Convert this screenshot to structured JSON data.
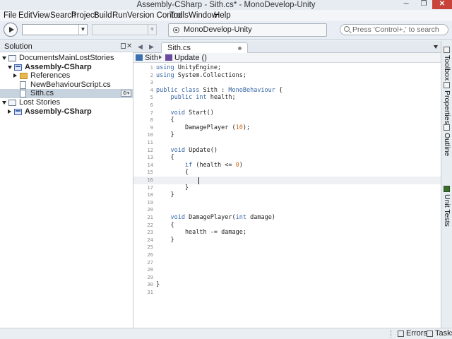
{
  "window": {
    "title": "Assembly-CSharp - Sith.cs* - MonoDevelop-Unity",
    "min": "─",
    "max": "❐",
    "close": "✕"
  },
  "menu": [
    "File",
    "Edit",
    "View",
    "Search",
    "Project",
    "Build",
    "Run",
    "Version Control",
    "Tools",
    "Window",
    "Help"
  ],
  "toolbar": {
    "config_value": "",
    "platform_value": "",
    "status_text": "MonoDevelop-Unity",
    "search_placeholder": "Press 'Control+,' to search"
  },
  "solution": {
    "title": "Solution",
    "close": "✕",
    "tree": [
      {
        "label": "DocumentsMainLostStories",
        "bold": false,
        "icon": "solution-icon",
        "expander": "down",
        "indent": 0
      },
      {
        "label": "Assembly-CSharp",
        "bold": true,
        "icon": "project-icon",
        "expander": "down",
        "indent": 1
      },
      {
        "label": "References",
        "bold": false,
        "icon": "folder-icon",
        "expander": "right",
        "indent": 2
      },
      {
        "label": "NewBehaviourScript.cs",
        "bold": false,
        "icon": "file-icon",
        "expander": "",
        "indent": 2
      },
      {
        "label": "Sith.cs",
        "bold": false,
        "icon": "file-icon",
        "expander": "",
        "indent": 2,
        "selected": true
      },
      {
        "label": "Lost Stories",
        "bold": false,
        "icon": "solution-icon",
        "expander": "down",
        "indent": 0
      },
      {
        "label": "Assembly-CSharp",
        "bold": true,
        "icon": "project-icon",
        "expander": "right",
        "indent": 1
      }
    ],
    "gear": "⚙▾"
  },
  "editor": {
    "tab_label": "Sith.cs",
    "nav_back": "◀",
    "nav_forward": "▶",
    "path_class": "Sith",
    "path_member": "Update ()",
    "current_line": 16,
    "lines": [
      [
        {
          "t": "using",
          "c": "kw"
        },
        {
          "t": " UnityEngine;"
        }
      ],
      [
        {
          "t": "using",
          "c": "kw"
        },
        {
          "t": " System.Collections;"
        }
      ],
      [],
      [
        {
          "t": "public class",
          "c": "kw"
        },
        {
          "t": " Sith : "
        },
        {
          "t": "MonoBehaviour",
          "c": "kw"
        },
        {
          "t": " {"
        }
      ],
      [
        {
          "t": "    "
        },
        {
          "t": "public int",
          "c": "kw"
        },
        {
          "t": " health;"
        }
      ],
      [],
      [
        {
          "t": "    "
        },
        {
          "t": "void",
          "c": "kw"
        },
        {
          "t": " Start()"
        }
      ],
      [
        {
          "t": "    {"
        }
      ],
      [
        {
          "t": "        DamagePlayer ("
        },
        {
          "t": "10",
          "c": "num"
        },
        {
          "t": ");"
        }
      ],
      [
        {
          "t": "    }"
        }
      ],
      [],
      [
        {
          "t": "    "
        },
        {
          "t": "void",
          "c": "kw"
        },
        {
          "t": " Update()"
        }
      ],
      [
        {
          "t": "    {"
        }
      ],
      [
        {
          "t": "        "
        },
        {
          "t": "if",
          "c": "kw"
        },
        {
          "t": " (health <= "
        },
        {
          "t": "0",
          "c": "num"
        },
        {
          "t": ")"
        }
      ],
      [
        {
          "t": "        {"
        }
      ],
      [],
      [
        {
          "t": "        }"
        }
      ],
      [
        {
          "t": "    }"
        }
      ],
      [],
      [],
      [
        {
          "t": "    "
        },
        {
          "t": "void",
          "c": "kw"
        },
        {
          "t": " DamagePlayer("
        },
        {
          "t": "int",
          "c": "kw"
        },
        {
          "t": " damage)"
        }
      ],
      [
        {
          "t": "    {"
        }
      ],
      [
        {
          "t": "        health -= damage;"
        }
      ],
      [
        {
          "t": "    }"
        }
      ],
      [],
      [],
      [],
      [],
      [],
      [
        {
          "t": "}"
        }
      ],
      []
    ]
  },
  "dock": [
    {
      "label": "Toolbox",
      "icon": "toolbox-icon"
    },
    {
      "label": "Properties",
      "icon": "properties-icon"
    },
    {
      "label": "Document Outline",
      "icon": "outline-icon"
    },
    {
      "label": "Unit Tests",
      "icon": "unit-tests-icon"
    }
  ],
  "statusbar": {
    "errors": "Errors",
    "tasks": "Tasks"
  }
}
